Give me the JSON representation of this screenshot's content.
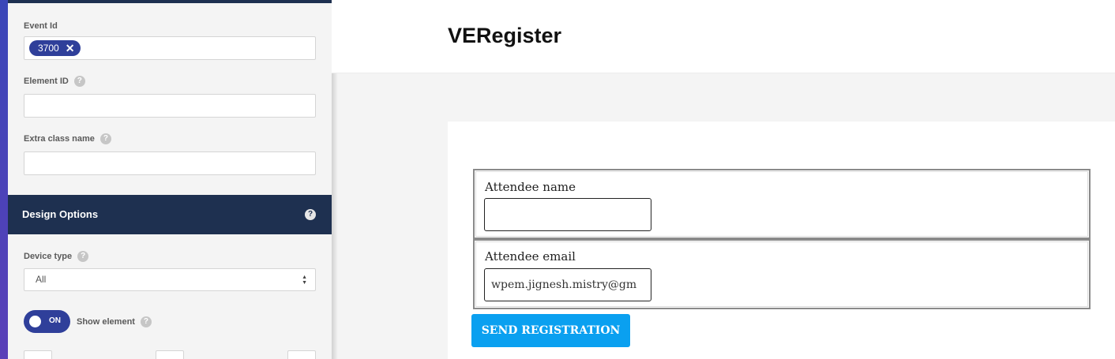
{
  "editor": {
    "event_id": {
      "label": "Event Id",
      "tag_value": "3700",
      "tag_remove_icon": "close-icon"
    },
    "element_id": {
      "label": "Element ID",
      "value": ""
    },
    "extra_class": {
      "label": "Extra class name",
      "value": ""
    },
    "help_glyph": "?",
    "design_options": {
      "title": "Design Options"
    },
    "device_type": {
      "label": "Device type",
      "selected": "All"
    },
    "show_element": {
      "toggle_state": "ON",
      "label": "Show element"
    }
  },
  "preview": {
    "site_title": "VERegister",
    "form": {
      "name_label": "Attendee name",
      "name_value": "",
      "email_label": "Attendee email",
      "email_value": "wpem.jignesh.mistry@gm",
      "submit_label": "SEND REGISTRATION"
    }
  },
  "colors": {
    "panel_dark": "#1e3050",
    "tag_blue": "#2f3f9a",
    "button_blue": "#0aa0f0"
  }
}
